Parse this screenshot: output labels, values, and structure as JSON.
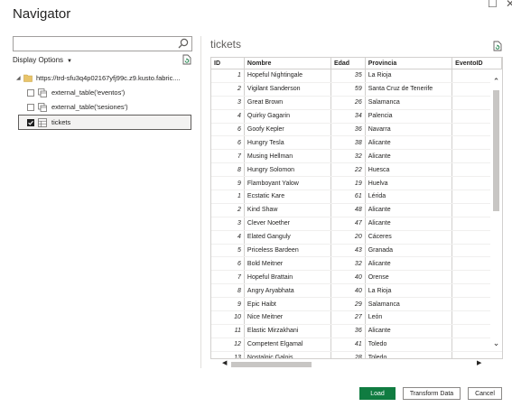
{
  "window": {
    "title": "Navigator",
    "restore_glyph": "☐",
    "close_glyph": "✕"
  },
  "search": {
    "value": "",
    "placeholder": ""
  },
  "display_options": {
    "label": "Display Options",
    "caret": "▼"
  },
  "tree": {
    "root": {
      "label": "https://trd-sfu3q4p02167yfj99c.z9.kusto.fabric....",
      "expanded": true,
      "expander": "◢"
    },
    "items": [
      {
        "label": "external_table('eventos')",
        "checked": false,
        "icon": "external-table-icon"
      },
      {
        "label": "external_table('sesiones')",
        "checked": false,
        "icon": "external-table-icon"
      },
      {
        "label": "tickets",
        "checked": true,
        "icon": "table-icon"
      }
    ]
  },
  "preview": {
    "title": "tickets",
    "columns": [
      "ID",
      "Nombre",
      "Edad",
      "Provincia",
      "EventoID"
    ],
    "rows": [
      [
        "1",
        "Hopeful Nightingale",
        "35",
        "La Rioja"
      ],
      [
        "2",
        "Vigilant Sanderson",
        "59",
        "Santa Cruz de Tenerife"
      ],
      [
        "3",
        "Great Brown",
        "26",
        "Salamanca"
      ],
      [
        "4",
        "Quirky Gagarin",
        "34",
        "Palencia"
      ],
      [
        "6",
        "Goofy Kepler",
        "36",
        "Navarra"
      ],
      [
        "6",
        "Hungry Tesla",
        "38",
        "Alicante"
      ],
      [
        "7",
        "Musing Hellman",
        "32",
        "Alicante"
      ],
      [
        "8",
        "Hungry Solomon",
        "22",
        "Huesca"
      ],
      [
        "9",
        "Flamboyant Yalow",
        "19",
        "Huelva"
      ],
      [
        "1",
        "Ecstatic Kare",
        "61",
        "Lérida"
      ],
      [
        "2",
        "Kind Shaw",
        "48",
        "Alicante"
      ],
      [
        "3",
        "Clever Noether",
        "47",
        "Alicante"
      ],
      [
        "4",
        "Elated Ganguly",
        "20",
        "Cáceres"
      ],
      [
        "5",
        "Priceless Bardeen",
        "43",
        "Granada"
      ],
      [
        "6",
        "Bold Meitner",
        "32",
        "Alicante"
      ],
      [
        "7",
        "Hopeful Brattain",
        "40",
        "Orense"
      ],
      [
        "8",
        "Angry Aryabhata",
        "40",
        "La Rioja"
      ],
      [
        "9",
        "Epic Haibt",
        "29",
        "Salamanca"
      ],
      [
        "10",
        "Nice Meitner",
        "27",
        "León"
      ],
      [
        "11",
        "Elastic Mirzakhani",
        "36",
        "Alicante"
      ],
      [
        "12",
        "Competent Elgamal",
        "41",
        "Toledo"
      ],
      [
        "13",
        "Nostalgic Galois",
        "28",
        "Toledo"
      ],
      [
        "14",
        "Exciting Lamarr",
        "53",
        "Alicante"
      ]
    ],
    "scroll": {
      "up": "⌃",
      "down": "⌄",
      "left": "◀",
      "right": "▶"
    }
  },
  "buttons": {
    "load": "Load",
    "transform": "Transform Data",
    "cancel": "Cancel"
  },
  "colors": {
    "accent": "#107c41",
    "selection_bg": "#f3f2f1",
    "border": "#8a8886"
  }
}
